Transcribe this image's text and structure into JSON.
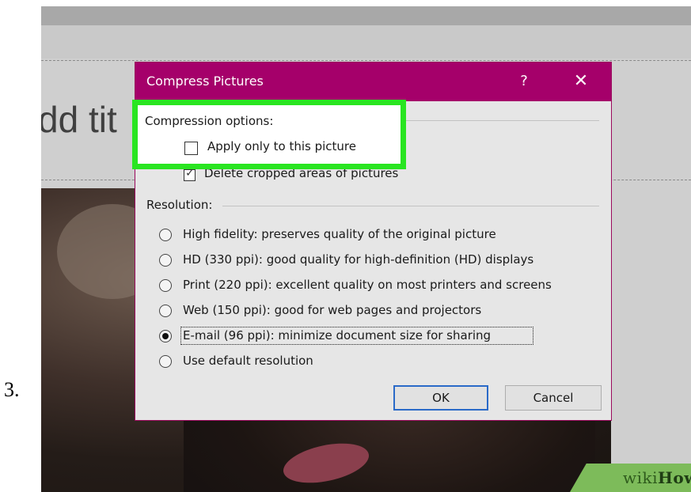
{
  "step_number": "3.",
  "slide": {
    "title_fragment": "dd tit"
  },
  "watermark": {
    "wiki": "wiki",
    "how": "How"
  },
  "dialog": {
    "title": "Compress Pictures",
    "help_label": "?",
    "close_label": "✕",
    "compression_options": {
      "heading": "Compression options:",
      "apply_only": {
        "label": "Apply only to this picture",
        "checked": false
      },
      "delete_cropped": {
        "label": "Delete cropped areas of pictures",
        "checked": true
      }
    },
    "resolution": {
      "heading": "Resolution:",
      "options": [
        {
          "label": "High fidelity: preserves quality of the original picture",
          "selected": false
        },
        {
          "label": "HD (330 ppi): good quality for high-definition (HD) displays",
          "selected": false
        },
        {
          "label": "Print (220 ppi): excellent quality on most printers and screens",
          "selected": false
        },
        {
          "label": "Web (150 ppi): good for web pages and projectors",
          "selected": false
        },
        {
          "label": "E-mail (96 ppi): minimize document size for sharing",
          "selected": true
        },
        {
          "label": "Use default resolution",
          "selected": false
        }
      ]
    },
    "ok_label": "OK",
    "cancel_label": "Cancel"
  },
  "colors": {
    "titlebar": "#a5006a",
    "highlight": "#29e521",
    "ok_border": "#2a6ac8"
  }
}
